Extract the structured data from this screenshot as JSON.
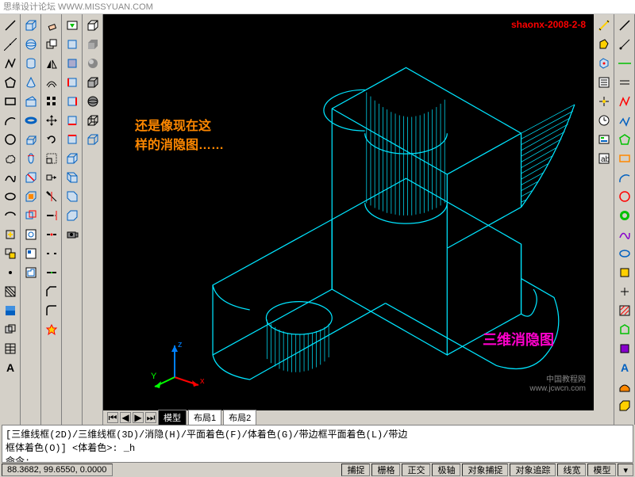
{
  "titlebar_text": "思缘设计论坛 WWW.MISSYUAN.COM",
  "watermark_top": "shaonx-2008-2-8",
  "annotation_left_line1": "还是像现在这",
  "annotation_left_line2": "样的消隐图……",
  "annotation_right": "三维消隐图",
  "watermark_br_line1": "中国教程网",
  "watermark_br_line2": "www.jcwcn.com",
  "ucs": {
    "x": "x",
    "y": "Y",
    "z": "z"
  },
  "tabs": {
    "model": "模型",
    "layout1": "布局1",
    "layout2": "布局2"
  },
  "command": {
    "line1": "[三维线框(2D)/三维线框(3D)/消隐(H)/平面着色(F)/体着色(G)/带边框平面着色(L)/带边",
    "line2": "框体着色(O)] <体着色>: _h",
    "prompt": "命令:"
  },
  "status": {
    "coords": "88.3682, 99.6550, 0.0000",
    "snap": "捕捉",
    "grid": "栅格",
    "ortho": "正交",
    "polar": "极轴",
    "osnap": "对象捕捉",
    "otrack": "对象追踪",
    "lwt": "线宽",
    "model": "模型"
  },
  "icon_colors": {
    "cyan": "#00e5ff",
    "yellow": "#ffd000",
    "green": "#00c000",
    "blue": "#0060c0",
    "red": "#ff0000",
    "orange": "#ff8800",
    "gray": "#888888",
    "purple": "#8800cc"
  }
}
